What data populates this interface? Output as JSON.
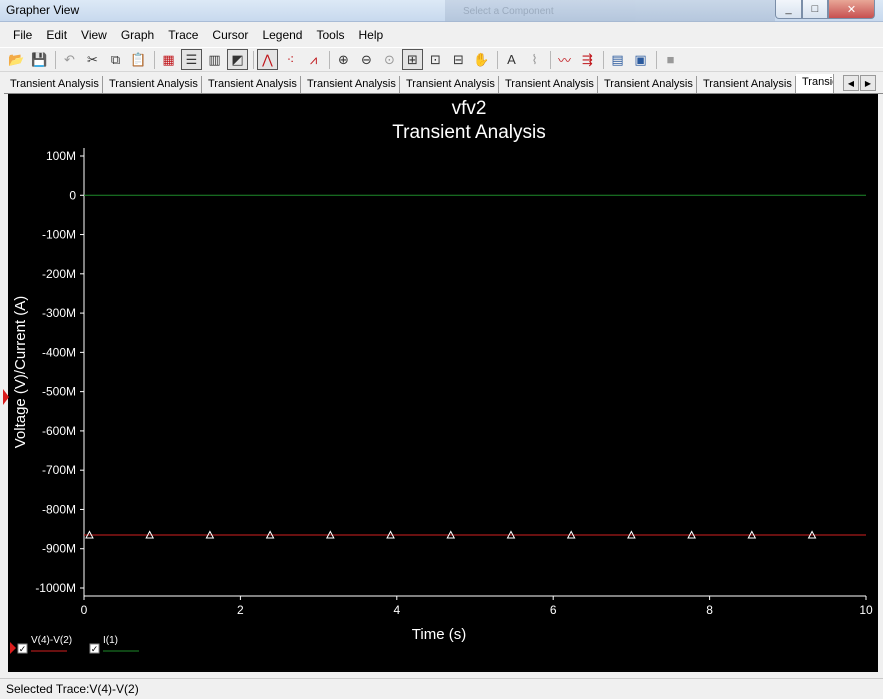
{
  "window": {
    "title": "Grapher View",
    "background_window_title": "Select a Component",
    "controls": [
      "_",
      "□",
      "✕"
    ]
  },
  "menu": [
    "File",
    "Edit",
    "View",
    "Graph",
    "Trace",
    "Cursor",
    "Legend",
    "Tools",
    "Help"
  ],
  "toolbar": {
    "buttons": [
      {
        "name": "open-icon",
        "glyph": "📂",
        "color": "dark"
      },
      {
        "name": "save-icon",
        "glyph": "💾",
        "color": "dark"
      },
      {
        "sep": true
      },
      {
        "name": "undo-icon",
        "glyph": "↶",
        "color": "grey"
      },
      {
        "name": "cut-icon",
        "glyph": "✂",
        "color": "dark"
      },
      {
        "name": "copy-icon",
        "glyph": "⧉",
        "color": "dark"
      },
      {
        "name": "paste-icon",
        "glyph": "📋",
        "color": "grey"
      },
      {
        "sep": true
      },
      {
        "name": "grid-icon",
        "glyph": "▦",
        "color": "red"
      },
      {
        "name": "legend-icon",
        "glyph": "☰",
        "color": "dark",
        "pressed": true
      },
      {
        "name": "bar-chart-icon",
        "glyph": "▥",
        "color": "dark"
      },
      {
        "name": "overlay-icon",
        "glyph": "◩",
        "color": "dark",
        "pressed": true
      },
      {
        "sep": true
      },
      {
        "name": "trace-line-icon",
        "glyph": "⋀",
        "color": "red",
        "pressed": true
      },
      {
        "name": "trace-points-icon",
        "glyph": "⁖",
        "color": "red"
      },
      {
        "name": "trace-line-points-icon",
        "glyph": "⩘",
        "color": "red"
      },
      {
        "sep": true
      },
      {
        "name": "zoom-in-icon",
        "glyph": "⊕",
        "color": "dark"
      },
      {
        "name": "zoom-out-icon",
        "glyph": "⊖",
        "color": "dark"
      },
      {
        "name": "zoom-area-icon",
        "glyph": "⊙",
        "color": "grey"
      },
      {
        "name": "zoom-fit-icon",
        "glyph": "⊞",
        "color": "dark",
        "pressed": true
      },
      {
        "name": "zoom-x-icon",
        "glyph": "⊡",
        "color": "dark"
      },
      {
        "name": "zoom-y-icon",
        "glyph": "⊟",
        "color": "dark"
      },
      {
        "name": "pan-hand-icon",
        "glyph": "✋",
        "color": "dark"
      },
      {
        "sep": true
      },
      {
        "name": "text-icon",
        "glyph": "A",
        "color": "dark"
      },
      {
        "name": "probe-icon",
        "glyph": "⌇",
        "color": "grey"
      },
      {
        "sep": true
      },
      {
        "name": "cursor-trace-icon",
        "glyph": "〰",
        "color": "red"
      },
      {
        "name": "export-data-icon",
        "glyph": "⇶",
        "color": "red"
      },
      {
        "sep": true
      },
      {
        "name": "copy-graph-icon",
        "glyph": "▤",
        "color": "blue"
      },
      {
        "name": "paste-graph-icon",
        "glyph": "▣",
        "color": "blue"
      },
      {
        "sep": true
      },
      {
        "name": "stop-icon",
        "glyph": "■",
        "color": "grey"
      }
    ]
  },
  "tabs": [
    {
      "label": "Transient Analysis"
    },
    {
      "label": "Transient Analysis"
    },
    {
      "label": "Transient Analysis"
    },
    {
      "label": "Transient Analysis"
    },
    {
      "label": "Transient Analysis"
    },
    {
      "label": "Transient Analysis"
    },
    {
      "label": "Transient Analysis"
    },
    {
      "label": "Transient Analysis"
    },
    {
      "label": "Transient Analysis",
      "active": true
    }
  ],
  "tab_scroll": {
    "left": "◀",
    "right": "▶"
  },
  "chart_data": {
    "type": "line",
    "title": "vfv2",
    "subtitle": "Transient Analysis",
    "xlabel": "Time (s)",
    "ylabel": "Voltage (V)/Current (A)",
    "xlim": [
      0,
      10
    ],
    "ylim": [
      -1000,
      100
    ],
    "x_ticks": [
      0,
      2,
      4,
      6,
      8,
      10
    ],
    "x_tick_labels": [
      "0",
      "2",
      "4",
      "6",
      "8",
      "10"
    ],
    "y_ticks": [
      100,
      0,
      -100,
      -200,
      -300,
      -400,
      -500,
      -600,
      -700,
      -800,
      -900,
      -1000
    ],
    "y_tick_labels": [
      "100M",
      "0",
      "-100M",
      "-200M",
      "-300M",
      "-400M",
      "-500M",
      "-600M",
      "-700M",
      "-800M",
      "-900M",
      "-1000M"
    ],
    "grid": false,
    "series": [
      {
        "name": "V(4)-V(2)",
        "color": "#d21f1f",
        "x": [
          0,
          10
        ],
        "y": [
          -865,
          -865
        ],
        "markers_x": [
          0.07,
          0.84,
          1.61,
          2.38,
          3.15,
          3.92,
          4.69,
          5.46,
          6.23,
          7.0,
          7.77,
          8.54,
          9.31
        ],
        "marker": "triangle"
      },
      {
        "name": "I(1)",
        "color": "#1e8a2a",
        "x": [
          0,
          10
        ],
        "y": [
          0,
          0
        ]
      }
    ],
    "legend": [
      {
        "label": "V(4)-V(2)",
        "color": "#d21f1f",
        "checked": true,
        "selected": true
      },
      {
        "label": "I(1)",
        "color": "#1e8a2a",
        "checked": true
      }
    ],
    "legend_position": "bottom-left"
  },
  "status": {
    "text": "Selected Trace:V(4)-V(2)"
  }
}
